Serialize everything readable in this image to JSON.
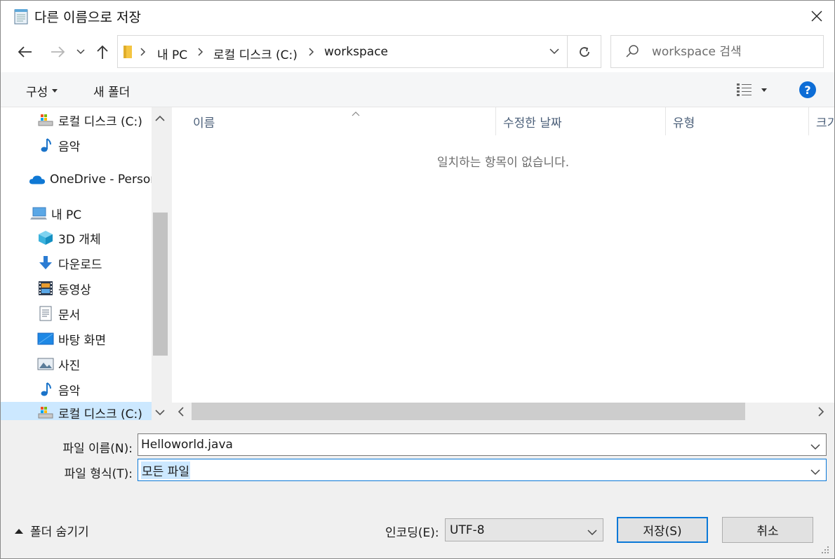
{
  "window": {
    "title": "다른 이름으로 저장",
    "icons": {
      "app": "notepad-icon",
      "close": "close-icon"
    }
  },
  "nav": {
    "breadcrumb": [
      "내 PC",
      "로컬 디스크 (C:)",
      "workspace"
    ],
    "icons": [
      "back-arrow-icon",
      "forward-arrow-icon",
      "recent-dropdown-icon",
      "up-arrow-icon",
      "folder-icon",
      "chevron-down-icon",
      "refresh-icon"
    ]
  },
  "search": {
    "placeholder": "workspace 검색"
  },
  "toolbar": {
    "organize_label": "구성",
    "new_folder_label": "새 폴더",
    "help_label": "?"
  },
  "sidebar": {
    "items": [
      {
        "label": "로컬 디스크 (C:)",
        "icon": "drive-icon"
      },
      {
        "label": "음악",
        "icon": "music-icon"
      },
      {
        "label": "OneDrive - Persor",
        "icon": "cloud-icon"
      },
      {
        "label": "내 PC",
        "icon": "computer-icon"
      },
      {
        "label": "3D 개체",
        "icon": "cube-icon"
      },
      {
        "label": "다운로드",
        "icon": "download-icon"
      },
      {
        "label": "동영상",
        "icon": "video-icon"
      },
      {
        "label": "문서",
        "icon": "document-icon"
      },
      {
        "label": "바탕 화면",
        "icon": "desktop-icon"
      },
      {
        "label": "사진",
        "icon": "picture-icon"
      },
      {
        "label": "음악",
        "icon": "music-icon"
      },
      {
        "label": "로컬 디스크 (C:)",
        "icon": "drive-icon"
      }
    ]
  },
  "filelist": {
    "columns": [
      "이름",
      "수정한 날짜",
      "유형",
      "크기"
    ],
    "empty_message": "일치하는 항목이 없습니다."
  },
  "form": {
    "filename_label": "파일 이름(N):",
    "filename_value": "Helloworld.java",
    "filetype_label": "파일 형식(T):",
    "filetype_value": "모든 파일",
    "encoding_label": "인코딩(E):",
    "encoding_value": "UTF-8",
    "hide_folders_label": "폴더 숨기기",
    "save_label": "저장(S)",
    "cancel_label": "취소"
  },
  "colors": {
    "accent": "#0a78d7",
    "selection": "#cce8ff",
    "help": "#0d6dd6",
    "folder": "#f4c542"
  }
}
